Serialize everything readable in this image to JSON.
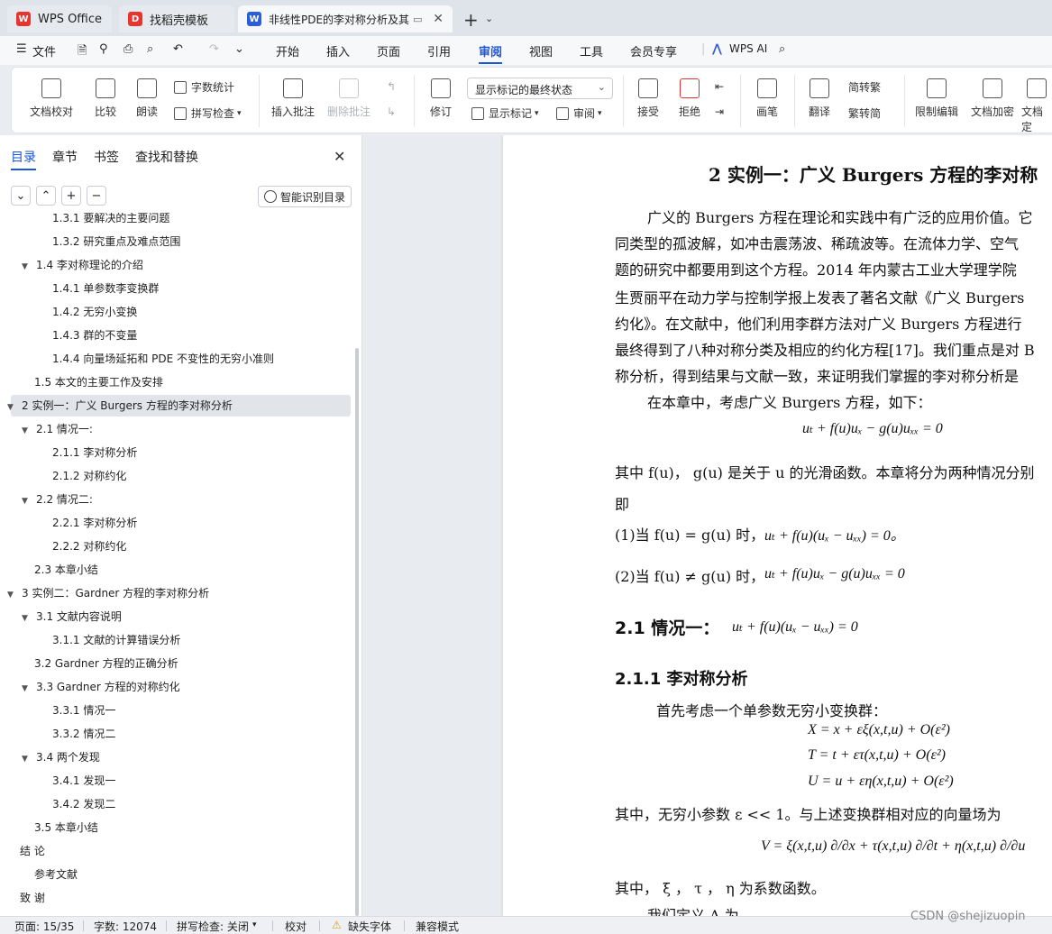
{
  "tabs": [
    {
      "label": "WPS Office"
    },
    {
      "label": "找稻壳模板"
    },
    {
      "label": "非线性PDE的李对称分析及其"
    }
  ],
  "menu": {
    "file": "文件",
    "items": [
      "开始",
      "插入",
      "页面",
      "引用",
      "审阅",
      "视图",
      "工具",
      "会员专享"
    ],
    "active": "审阅",
    "ai": "WPS AI"
  },
  "ribbon": {
    "doc_check": "文档校对",
    "compare": "比较",
    "read_aloud": "朗读",
    "word_count": "字数统计",
    "spell_check": "拼写检查",
    "insert_comment": "插入批注",
    "delete_comment": "删除批注",
    "revise": "修订",
    "markup_dropdown": "显示标记的最终状态",
    "show_markup": "显示标记",
    "review": "审阅",
    "accept": "接受",
    "reject": "拒绝",
    "pen": "画笔",
    "translate": "翻译",
    "to_traditional": "简转繁",
    "to_simplified": "繁转简",
    "restrict_edit": "限制编辑",
    "doc_encrypt": "文档加密",
    "doc_final": "文档定"
  },
  "nav": {
    "tabs": [
      "目录",
      "章节",
      "书签",
      "查找和替换"
    ],
    "smart_btn": "智能识别目录",
    "toc": [
      {
        "text": "1.3.1  要解决的主要问题",
        "level": 3
      },
      {
        "text": "1.3.2  研究重点及难点范围",
        "level": 3
      },
      {
        "text": "1.4  李对称理论的介绍",
        "level": 2,
        "expand": true
      },
      {
        "text": "1.4.1  单参数李变换群",
        "level": 3
      },
      {
        "text": "1.4.2  无穷小变换",
        "level": 3
      },
      {
        "text": "1.4.3  群的不变量",
        "level": 3
      },
      {
        "text": "1.4.4  向量场延拓和 PDE 不变性的无穷小准则",
        "level": 3
      },
      {
        "text": "1.5  本文的主要工作及安排",
        "level": 2
      },
      {
        "text": "2  实例一：广义 Burgers 方程的李对称分析",
        "level": 1,
        "expand": true,
        "selected": true
      },
      {
        "text": "2.1  情况一:",
        "level": 2,
        "expand": true
      },
      {
        "text": "2.1.1  李对称分析",
        "level": 3
      },
      {
        "text": "2.1.2  对称约化",
        "level": 3
      },
      {
        "text": "2.2  情况二:",
        "level": 2,
        "expand": true
      },
      {
        "text": "2.2.1  李对称分析",
        "level": 3
      },
      {
        "text": "2.2.2  对称约化",
        "level": 3
      },
      {
        "text": "2.3  本章小结",
        "level": 2
      },
      {
        "text": "3  实例二：Gardner 方程的李对称分析",
        "level": 1,
        "expand": true
      },
      {
        "text": "3.1  文献内容说明",
        "level": 2,
        "expand": true
      },
      {
        "text": "3.1.1  文献的计算错误分析",
        "level": 3
      },
      {
        "text": "3.2 Gardner 方程的正确分析",
        "level": 2
      },
      {
        "text": "3.3 Gardner 方程的对称约化",
        "level": 2,
        "expand": true
      },
      {
        "text": "3.3.1  情况一",
        "level": 3
      },
      {
        "text": "3.3.2  情况二",
        "level": 3
      },
      {
        "text": "3.4  两个发现",
        "level": 2,
        "expand": true
      },
      {
        "text": "3.4.1  发现一",
        "level": 3
      },
      {
        "text": "3.4.2  发现二",
        "level": 3
      },
      {
        "text": "3.5  本章小结",
        "level": 2
      },
      {
        "text": "结  论",
        "level": 1
      },
      {
        "text": "参考文献",
        "level": 2
      },
      {
        "text": "致  谢",
        "level": 1
      }
    ]
  },
  "doc": {
    "heading": "2  实例一：广义 Burgers 方程的李对称",
    "para1": [
      "广义的 Burgers 方程在理论和实践中有广泛的应用价值。它",
      "同类型的孤波解，如冲击震荡波、稀疏波等。在流体力学、空气",
      "题的研究中都要用到这个方程。2014 年内蒙古工业大学理学院",
      "生贾丽平在动力学与控制学报上发表了著名文献《广义 Burgers",
      "约化》。在文献中，他们利用李群方法对广义  Burgers  方程进行",
      "最终得到了八种对称分类及相应的约化方程[17]。我们重点是对 B",
      "称分析，得到结果与文献一致，来证明我们掌握的李对称分析是"
    ],
    "para2": "在本章中，考虑广义 Burgers 方程，如下：",
    "eq1": "uₜ + f(u)uₓ − g(u)uₓₓ = 0",
    "para3": "其中 f(u)，  g(u) 是关于 u 的光滑函数。本章将分为两种情况分别",
    "para3b": "即",
    "case1_prefix": "(1)当 f(u) = g(u) 时，",
    "case1_eq": "uₜ + f(u)(uₓ − uₓₓ) = 0。",
    "case2_prefix": "(2)当 f(u) ≠ g(u) 时，",
    "case2_eq": "uₜ + f(u)uₓ − g(u)uₓₓ = 0",
    "h21": "2.1  情况一：",
    "h21_eq": "uₜ + f(u)(uₓ − uₓₓ) = 0",
    "h211": "2.1.1  李对称分析",
    "para4": "首先考虑一个单参数无穷小变换群：",
    "eqX": "X = x + εξ(x,t,u) + O(ε²)",
    "eqT": "T = t + ετ(x,t,u) + O(ε²)",
    "eqU": "U = u + εη(x,t,u) + O(ε²)",
    "para5": "其中，无穷小参数 ε << 1。与上述变换群相对应的向量场为",
    "eqV": "V = ξ(x,t,u) ∂/∂x + τ(x,t,u) ∂/∂t + η(x,t,u) ∂/∂u",
    "para6": "其中，  ξ ，  τ ，  η 为系数函数。",
    "para7": "我们定义 A 为"
  },
  "status": {
    "page": "页面: 15/35",
    "words": "字数: 12074",
    "spell": "拼写检查: 关闭",
    "proof": "校对",
    "missing_font": "缺失字体",
    "compat": "兼容模式"
  },
  "watermark": "CSDN @shejizuopin",
  "colors": {
    "accent": "#1a56db",
    "wps_red": "#e8342e",
    "doc_blue": "#2b5fd9"
  }
}
